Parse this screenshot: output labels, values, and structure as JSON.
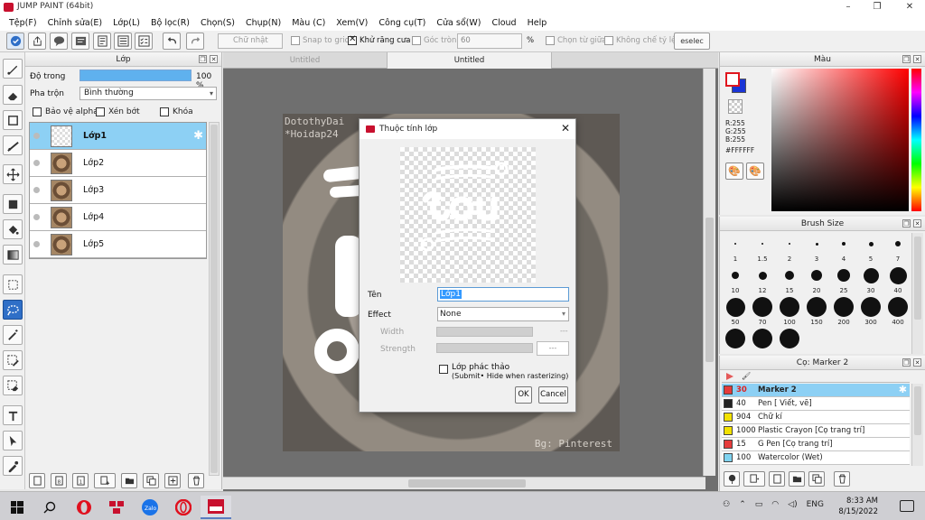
{
  "window": {
    "title": "JUMP PAINT (64bit)"
  },
  "menu": [
    "Tệp(F)",
    "Chỉnh sửa(E)",
    "Lớp(L)",
    "Bộ lọc(R)",
    "Chọn(S)",
    "Chụp(N)",
    "Màu (C)",
    "Xem(V)",
    "Công cụ(T)",
    "Cửa sổ(W)",
    "Cloud",
    "Help"
  ],
  "toolbar": {
    "shape_combo": "Chữ nhật",
    "snap_to_grid": "Snap to grid",
    "antialias": "Khử răng cưa",
    "corner": "Góc tròn",
    "corner_value": "60",
    "percent": "%",
    "select_center": "Chọn từ giữa",
    "no_ratio": "Không chế tỷ lệ",
    "deselect": "eselec"
  },
  "layer_panel": {
    "title": "Lớp",
    "opacity_label": "Độ trong",
    "opacity_value": "100 %",
    "opacity": 1.0,
    "blend_label": "Pha trộn",
    "blend_value": "Bình thường",
    "protect_alpha": "Bảo vệ alpha",
    "clip": "Xén bớt",
    "lock": "Khóa",
    "layers": [
      {
        "name": "Lớp1",
        "selected": true
      },
      {
        "name": "Lớp2",
        "selected": false
      },
      {
        "name": "Lớp3",
        "selected": false
      },
      {
        "name": "Lớp4",
        "selected": false
      },
      {
        "name": "Lớp5",
        "selected": false
      }
    ]
  },
  "doc_tabs": [
    "Untitled",
    "Untitled"
  ],
  "canvas": {
    "watermark": [
      "DotothyDai",
      "*Hoidap24"
    ],
    "credit": "Bg: Pinterest"
  },
  "dialog": {
    "title": "Thuộc tính lớp",
    "name_label": "Tên",
    "name_value": "Lớp1",
    "effect_label": "Effect",
    "effect_value": "None",
    "width_label": "Width",
    "strength_label": "Strength",
    "dots": "---",
    "sketch_label": "Lớp phác thảo",
    "sketch_note": "(Submit• Hide when rasterizing)",
    "ok": "OK",
    "cancel": "Cancel"
  },
  "color_panel": {
    "title": "Màu",
    "r": "R:255",
    "g": "G:255",
    "b": "B:255",
    "hex": "#FFFFFF",
    "fg_color": "#FFFFFF",
    "bg_color": "#1A35D6"
  },
  "brush_panel": {
    "title": "Brush Size",
    "sizes": [
      "1",
      "1.5",
      "2",
      "3",
      "4",
      "5",
      "7",
      "10",
      "12",
      "15",
      "20",
      "25",
      "30",
      "40",
      "50",
      "70",
      "100",
      "150",
      "200",
      "300",
      "400",
      "",
      "",
      ""
    ]
  },
  "sub_panel": {
    "title": "Cọ: Marker 2",
    "tools": [
      {
        "size": "30",
        "name": "Marker 2",
        "color": "#e53b3b",
        "selected": true
      },
      {
        "size": "40",
        "name": "Pen [ Viết, vẽ]",
        "color": "#222222",
        "selected": false
      },
      {
        "size": "904",
        "name": "Chữ kí",
        "color": "#f2e100",
        "selected": false
      },
      {
        "size": "1000",
        "name": "Plastic Crayon [Cọ trang trí]",
        "color": "#f2e100",
        "selected": false
      },
      {
        "size": "15",
        "name": "G Pen [Cọ trang trí]",
        "color": "#e53b3b",
        "selected": false
      },
      {
        "size": "100",
        "name": "Watercolor (Wet)",
        "color": "#7fd3f0",
        "selected": false
      }
    ]
  },
  "taskbar": {
    "time": "8:33 AM",
    "date": "8/15/2022",
    "lang": "ENG"
  }
}
